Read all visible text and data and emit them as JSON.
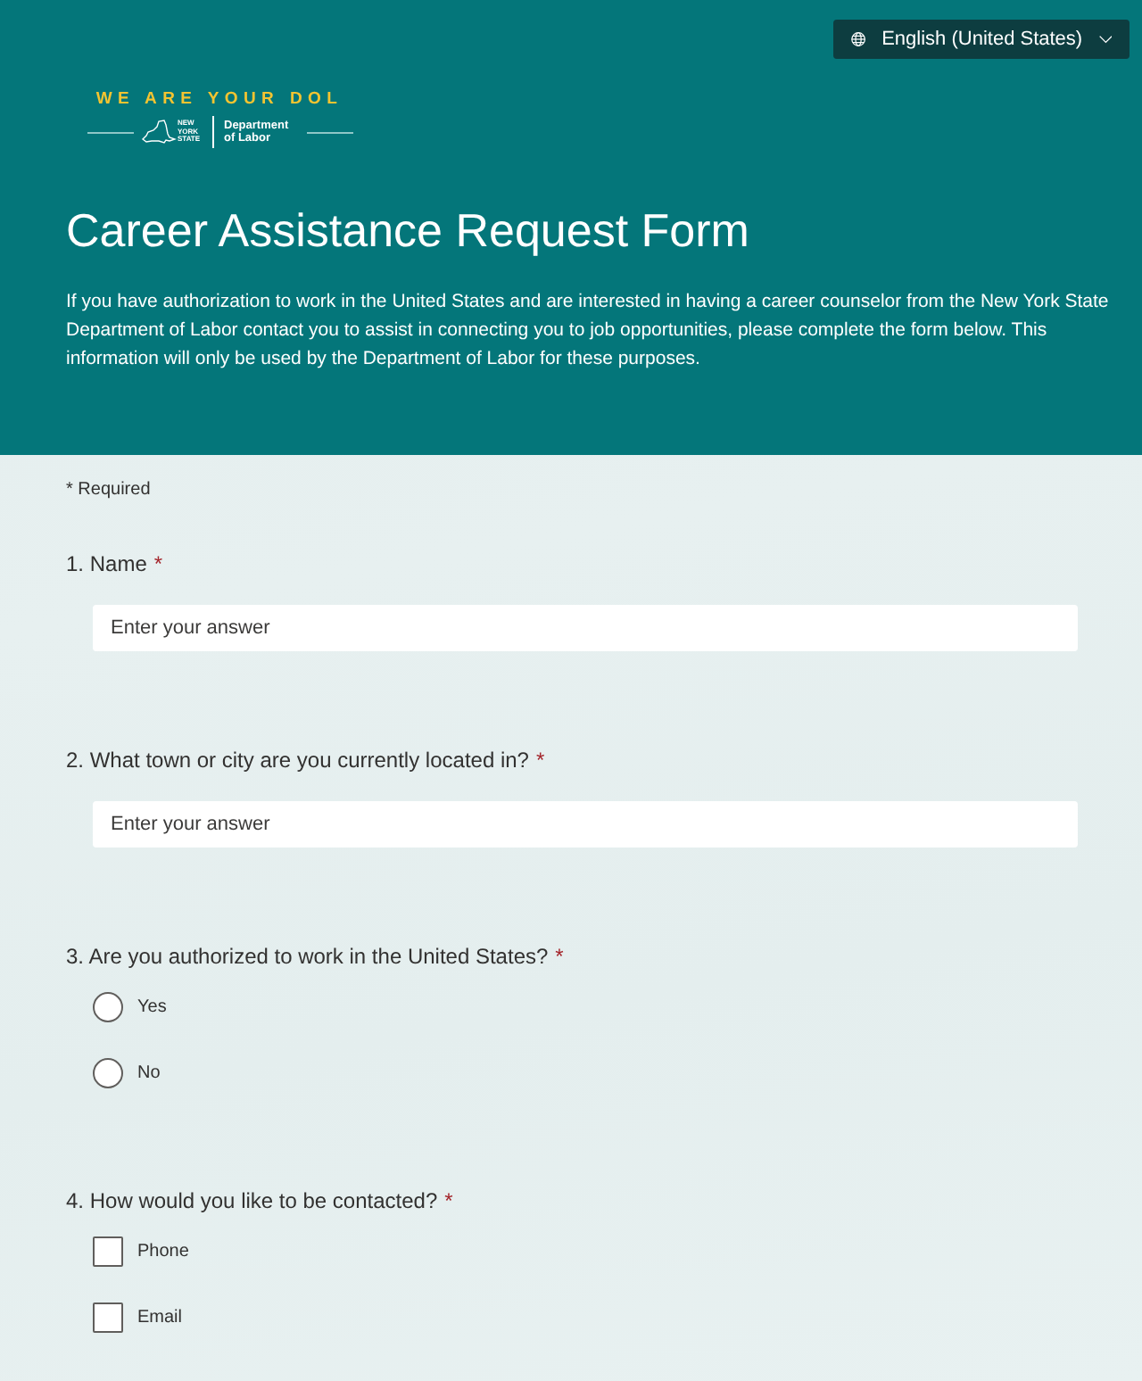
{
  "language_button": {
    "label": "English (United States)"
  },
  "logo": {
    "tagline": "WE ARE YOUR DOL",
    "state_mark": "NEW YORK STATE",
    "department": "Department of Labor"
  },
  "header": {
    "title": "Career Assistance Request Form",
    "description": "If you have authorization to work in the United States and are interested in having a career counselor from the New York State Department of Labor contact you to assist in connecting you to job opportunities, please complete the form below. This information will only be used by the Department of Labor for these purposes."
  },
  "required_note": "* Required",
  "questions": [
    {
      "number": "1.",
      "text": "Name",
      "required_mark": "*",
      "kind": "text",
      "placeholder": "Enter your answer"
    },
    {
      "number": "2.",
      "text": "What town or city are you currently located in?",
      "required_mark": "*",
      "kind": "text",
      "placeholder": "Enter your answer"
    },
    {
      "number": "3.",
      "text": "Are you authorized to work in the United States?",
      "required_mark": "*",
      "kind": "radio",
      "options": [
        {
          "label": "Yes",
          "selected": false
        },
        {
          "label": "No",
          "selected": false
        }
      ]
    },
    {
      "number": "4.",
      "text": "How would you like to be contacted?",
      "required_mark": "*",
      "kind": "checkbox",
      "options": [
        {
          "label": "Phone",
          "checked": false
        },
        {
          "label": "Email",
          "checked": false
        }
      ]
    }
  ]
}
